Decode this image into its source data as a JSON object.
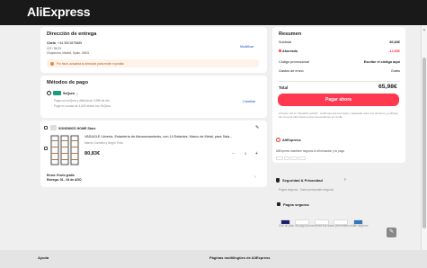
{
  "header": {
    "logo": "AliExpress"
  },
  "shipping": {
    "title": "Dirección de entrega",
    "name": "Chelo",
    "phone": "+34 3921879885",
    "line1": "107 / 56 23",
    "line2": "Chapinería, Madrid, Spain, 28001",
    "change_label": "Modificar",
    "warning": "Por favor, actualiza tu dirección para recibir el pedido"
  },
  "payment": {
    "title": "Métodos de pago",
    "method": "SeQura",
    "info": "ⓘ",
    "line1": "Paga con seQura y disfruta de 4,99€ de dto.",
    "line2": "Paga en cuotas de 4,62€ desde con SeQura",
    "change_label": "Cambiar"
  },
  "store": {
    "name": "SONGMICS HOME Store",
    "product_title": "VASAGLE Librería, Estantería de Almacenamiento, con 14 Estantes, Marco de Metal, para Sala...",
    "variant": "Marrón Camello y Negro Tinta",
    "price": "80,83€",
    "qty": "1",
    "shipping_label": "Envío: Envío gratis",
    "delivery": "Entrega: 01 - 04 de AGO"
  },
  "summary": {
    "title": "Resumen",
    "subtotal_label": "Subtotal",
    "subtotal": "80,83€",
    "savings_label": "Ahorrado",
    "savings": "-14,85€",
    "promo_label": "Código promocional",
    "promo_value": "Escribe el código aquí",
    "shipping_label": "Gastos de envío",
    "shipping_value": "Gratis",
    "total_label": "Total",
    "total": "65,98€",
    "pay_button": "Pagar ahora",
    "terms": "Al hacer clic en \"Realizar pedido\", confirmas que has leído y aceptado todos los términos y políticas, así como la información para consumidores en la UE."
  },
  "trust": {
    "brand": "AliExpress",
    "brand_text": "AliExpress mantiene seguros tu información y tu pago",
    "security_title": "Seguridad & Privacidad",
    "security_text": "Pagos seguros · Datos personales seguros",
    "secure_pay_title": "Pagos seguros",
    "secure_pay_text": "Con un plan de pago proveedores tus datos personales están seguros"
  },
  "footer": {
    "help": "Ayuda",
    "multi": "Páginas multilingües de AliExpress"
  },
  "colors": {
    "accent": "#fd384f",
    "topbar": "#191919",
    "link": "#1a4ec8"
  }
}
